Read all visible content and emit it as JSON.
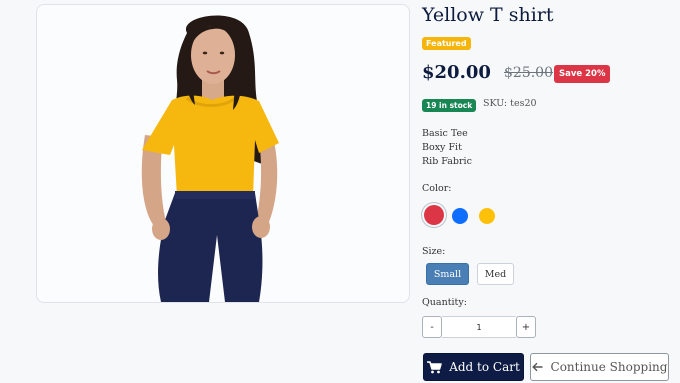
{
  "product": {
    "title": "Yellow T shirt",
    "featured_badge": "Featured",
    "price": "$20.00",
    "old_price": "$25.00",
    "save_badge": "Save 20%",
    "stock_badge": "19 in stock",
    "sku": "SKU: tes20",
    "features": [
      "Basic Tee",
      "Boxy Fit",
      "Rib Fabric"
    ],
    "image_icon": "model-wearing-yellow-tshirt"
  },
  "color": {
    "label": "Color:",
    "options": [
      {
        "name": "red",
        "hex": "#dc3545",
        "selected": true
      },
      {
        "name": "blue",
        "hex": "#0d6efd",
        "selected": false
      },
      {
        "name": "yellow",
        "hex": "#ffc107",
        "selected": false
      }
    ]
  },
  "size": {
    "label": "Size:",
    "options": [
      {
        "label": "Small",
        "selected": true
      },
      {
        "label": "Med",
        "selected": false
      }
    ]
  },
  "quantity": {
    "label": "Quantity:",
    "decrement": "-",
    "increment": "+",
    "value": "1"
  },
  "actions": {
    "add_to_cart": "Add to Cart",
    "add_to_cart_icon": "cart-icon",
    "continue_shopping": "Continue Shopping",
    "continue_icon": "arrow-left-icon"
  },
  "colors": {
    "primary": "#0d1b45",
    "featured": "#f5b50a",
    "sale": "#dc3545",
    "stock": "#198754",
    "size_active": "#4a7fb5"
  }
}
